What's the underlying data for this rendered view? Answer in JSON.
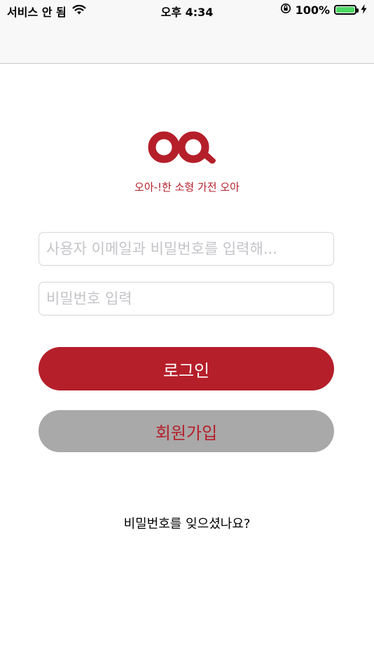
{
  "status_bar": {
    "carrier": "서비스 안 됨",
    "time": "오후 4:34",
    "battery_percent": "100%",
    "battery_level": 1.0,
    "icons": [
      "wifi-icon",
      "orientation-lock-icon",
      "battery-icon",
      "charging-icon"
    ]
  },
  "brand": {
    "tagline": "오아-!한 소형 가전 오아",
    "color": "#b51f2a"
  },
  "login_form": {
    "email_placeholder": "사용자 이메일과 비밀번호를 입력해...",
    "password_placeholder": "비밀번호 입력",
    "login_label": "로그인",
    "signup_label": "회원가입",
    "forgot_password_label": "비밀번호를 잊으셨나요?"
  },
  "colors": {
    "accent": "#b51f2a",
    "secondary_button": "#a9a9a9",
    "battery_fill": "#4cd964"
  }
}
